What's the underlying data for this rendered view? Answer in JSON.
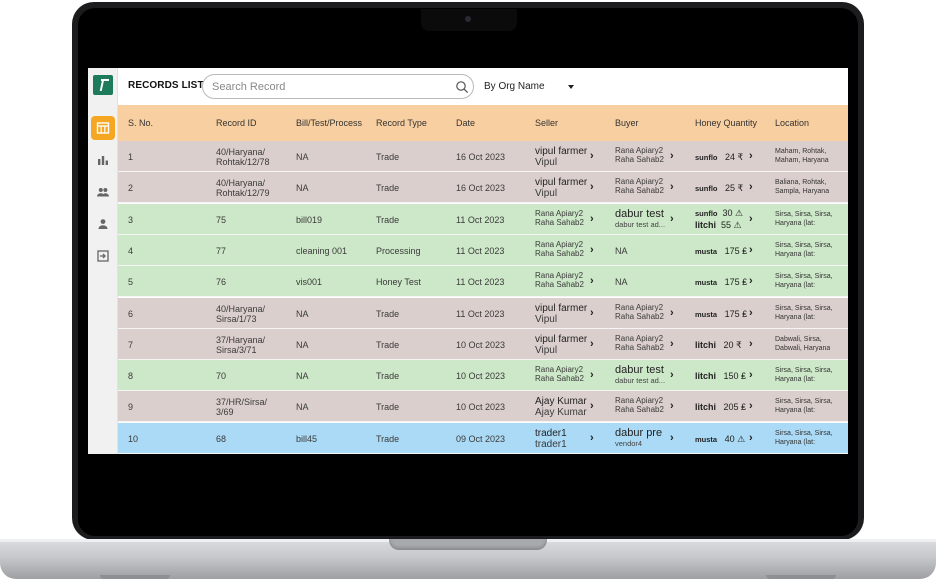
{
  "header": {
    "title": "RECORDS LIST",
    "search_placeholder": "Search Record",
    "org_filter": "By Org Name"
  },
  "sidebar": {
    "items": [
      "table-icon",
      "bar-chart-icon",
      "users-icon",
      "user-icon",
      "logout-icon"
    ]
  },
  "colors": {
    "header_bg": "#f8cfa0",
    "active_nav": "#f5a623",
    "trade_row": "#dbcfcd",
    "other_row": "#cde8c8",
    "selected_row": "#aadaf5"
  },
  "table": {
    "columns": [
      "S. No.",
      "Record ID",
      "Bill/Test/Process",
      "Record Type",
      "Date",
      "Seller",
      "Buyer",
      "Honey Quantity",
      "Location"
    ],
    "rows": [
      {
        "sno": "1",
        "id1": "40/Haryana/",
        "id2": "Rohtak/12/78",
        "bill": "NA",
        "type": "Trade",
        "date": "16 Oct 2023",
        "seller1": "vipul farmer",
        "seller2": "Vipul",
        "buyer1": "Rana Apiary2",
        "buyer2": "Raha Sahab2",
        "h1": "sunflo",
        "q1": "24 ₹",
        "h2": "",
        "q2": "",
        "loc1": "Maham, Rohtak,",
        "loc2": "Maham, Haryana"
      },
      {
        "sno": "2",
        "id1": "40/Haryana/",
        "id2": "Rohtak/12/79",
        "bill": "NA",
        "type": "Trade",
        "date": "16 Oct 2023",
        "seller1": "vipul farmer",
        "seller2": "Vipul",
        "buyer1": "Rana Apiary2",
        "buyer2": "Raha Sahab2",
        "h1": "sunflo",
        "q1": "25 ₹",
        "h2": "",
        "q2": "",
        "loc1": "Baliana, Rohtak,",
        "loc2": "Sampla, Haryana"
      },
      {
        "sno": "3",
        "id1": "75",
        "id2": "",
        "bill": "bill019",
        "type": "Trade",
        "date": "11 Oct 2023",
        "seller1": "Rana Apiary2",
        "seller2": "Raha Sahab2",
        "buyer1": "dabur test",
        "buyer2": "dabur test ad...",
        "h1": "sunflo",
        "q1": "30 ⚠",
        "h2": "litchi",
        "q2": "55 ⚠",
        "loc1": "Sirsa, Sirsa, Sirsa,",
        "loc2": "Haryana (lat:"
      },
      {
        "sno": "4",
        "id1": "77",
        "id2": "",
        "bill": "cleaning 001",
        "type": "Processing",
        "date": "11 Oct 2023",
        "seller1": "Rana Apiary2",
        "seller2": "Raha Sahab2",
        "buyer1": "NA",
        "buyer2": "",
        "h1": "musta",
        "q1": "175 ₤",
        "h2": "",
        "q2": "",
        "loc1": "Sirsa, Sirsa, Sirsa,",
        "loc2": "Haryana (lat:"
      },
      {
        "sno": "5",
        "id1": "76",
        "id2": "",
        "bill": "vis001",
        "type": "Honey Test",
        "date": "11 Oct 2023",
        "seller1": "Rana Apiary2",
        "seller2": "Raha Sahab2",
        "buyer1": "NA",
        "buyer2": "",
        "h1": "musta",
        "q1": "175 ₤",
        "h2": "",
        "q2": "",
        "loc1": "Sirsa, Sirsa, Sirsa,",
        "loc2": "Haryana (lat:"
      },
      {
        "sno": "6",
        "id1": "40/Haryana/",
        "id2": "Sirsa/1/73",
        "bill": "NA",
        "type": "Trade",
        "date": "11 Oct 2023",
        "seller1": "vipul farmer",
        "seller2": "Vipul",
        "buyer1": "Rana Apiary2",
        "buyer2": "Raha Sahab2",
        "h1": "musta",
        "q1": "175 ₤",
        "h2": "",
        "q2": "",
        "loc1": "Sirsa, Sirsa, Sirsa,",
        "loc2": "Haryana (lat:"
      },
      {
        "sno": "7",
        "id1": "37/Haryana/",
        "id2": "Sirsa/3/71",
        "bill": "NA",
        "type": "Trade",
        "date": "10 Oct 2023",
        "seller1": "vipul farmer",
        "seller2": "Vipul",
        "buyer1": "Rana Apiary2",
        "buyer2": "Raha Sahab2",
        "h1": "litchi",
        "q1": "20 ₹",
        "h2": "",
        "q2": "",
        "loc1": "Dabwali, Sirsa,",
        "loc2": "Dabwali, Haryana"
      },
      {
        "sno": "8",
        "id1": "70",
        "id2": "",
        "bill": "NA",
        "type": "Trade",
        "date": "10 Oct 2023",
        "seller1": "Rana Apiary2",
        "seller2": "Raha Sahab2",
        "buyer1": "dabur test",
        "buyer2": "dabur test ad...",
        "h1": "litchi",
        "q1": "150 ₤",
        "h2": "",
        "q2": "",
        "loc1": "Sirsa, Sirsa, Sirsa,",
        "loc2": "Haryana (lat:"
      },
      {
        "sno": "9",
        "id1": "37/HR/Sirsa/",
        "id2": "3/69",
        "bill": "NA",
        "type": "Trade",
        "date": "10 Oct 2023",
        "seller1": "Ajay Kumar",
        "seller2": "Ajay Kumar",
        "buyer1": "Rana Apiary2",
        "buyer2": "Raha Sahab2",
        "h1": "litchi",
        "q1": "205 ₤",
        "h2": "",
        "q2": "",
        "loc1": "Sirsa, Sirsa, Sirsa,",
        "loc2": "Haryana (lat:"
      },
      {
        "sno": "10",
        "id1": "68",
        "id2": "",
        "bill": "bill45",
        "type": "Trade",
        "date": "09 Oct 2023",
        "seller1": "trader1",
        "seller2": "trader1",
        "buyer1": "dabur pre",
        "buyer2": "vendor4",
        "h1": "musta",
        "q1": "40 ⚠",
        "h2": "",
        "q2": "",
        "loc1": "Sirsa, Sirsa, Sirsa,",
        "loc2": "Haryana (lat:"
      }
    ]
  }
}
